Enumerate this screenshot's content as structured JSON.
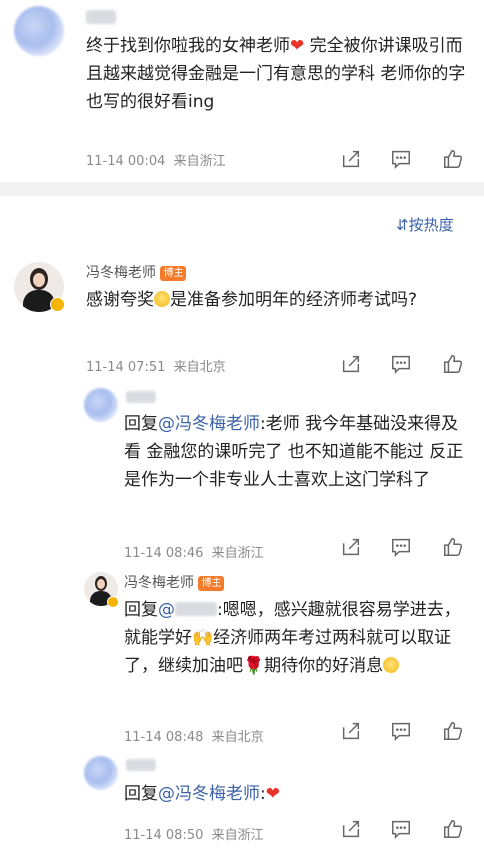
{
  "sort_label": "按热度",
  "comments": [
    {
      "text": "终于找到你啦我的女神老师",
      "text_after": " 完全被你讲课吸引而且越来越觉得金融是一门有意思的学科 老师你的字也写的很好看ing",
      "meta": "11-14 00:04  来自浙江"
    },
    {
      "author": "冯冬梅老师",
      "badge": "博主",
      "text": "感谢夸奖",
      "text_after": "是准备参加明年的经济师考试吗?",
      "meta": "11-14 07:51  来自北京"
    }
  ],
  "replies": [
    {
      "prefix": "回复",
      "mention": "@冯冬梅老师",
      "text": ":老师 我今年基础没来得及看 金融您的课听完了 也不知道能不能过 反正是作为一个非专业人士喜欢上这门学科了",
      "meta": "11-14 08:46  来自浙江"
    },
    {
      "author": "冯冬梅老师",
      "badge": "博主",
      "prefix": "回复",
      "mention": "@",
      "text": ":嗯嗯，感兴趣就很容易学进去，就能学好",
      "text_mid": "经济师两年考过两科就可以取证了，继续加油吧",
      "text_mid2": "期待你的好消息",
      "meta": "11-14 08:48  来自北京"
    },
    {
      "prefix": "回复",
      "mention": "@冯冬梅老师",
      "text": ":",
      "meta": "11-14 08:50  来自浙江"
    }
  ],
  "icons": [
    "share-icon",
    "comment-icon",
    "like-icon",
    "sort-icon"
  ]
}
